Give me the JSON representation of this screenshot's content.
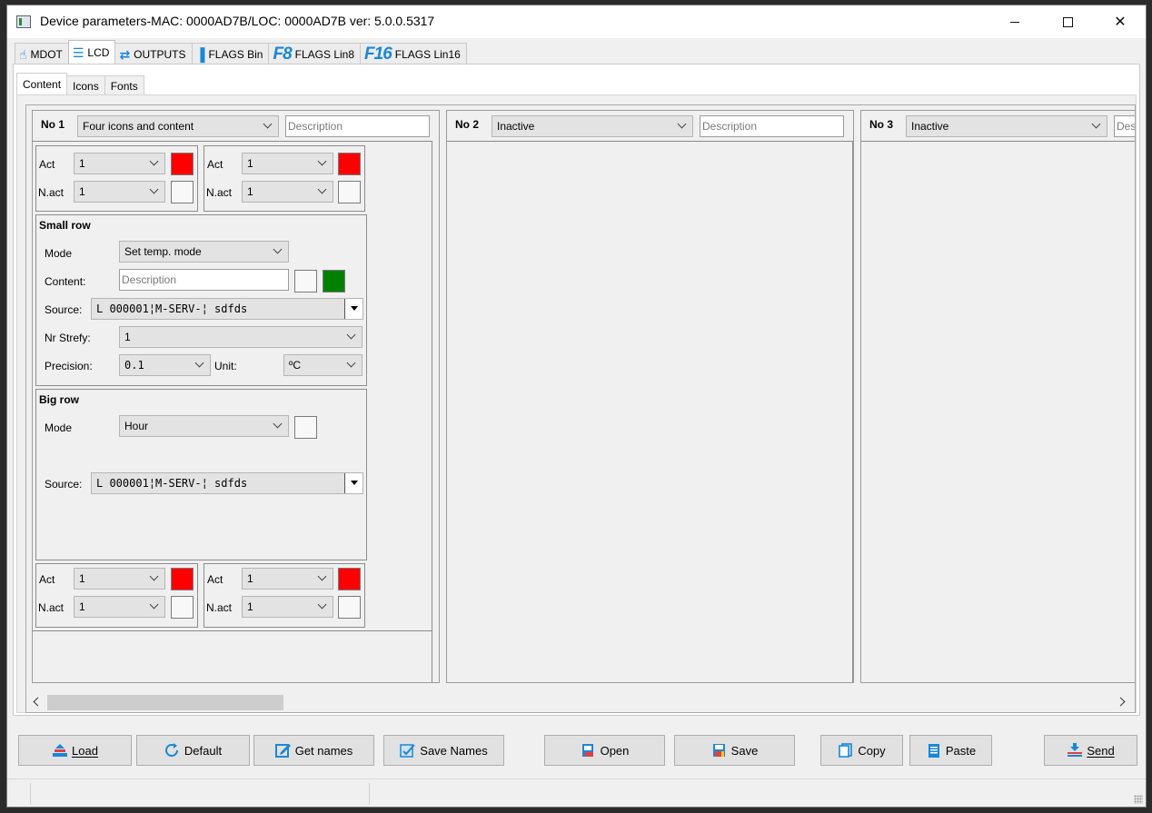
{
  "window": {
    "title": "Device parameters-MAC: 0000AD7B/LOC: 0000AD7B ver: 5.0.0.5317"
  },
  "main_tabs": [
    {
      "label": "MDOT",
      "icon": "touch-icon"
    },
    {
      "label": "LCD",
      "icon": "lcd-list-icon"
    },
    {
      "label": "OUTPUTS",
      "icon": "outputs-icon"
    },
    {
      "label": "FLAGS Bin",
      "icon": "flags-bin-icon"
    },
    {
      "label": "FLAGS Lin8",
      "icon_text": "F8"
    },
    {
      "label": "FLAGS Lin16",
      "icon_text": "F16"
    }
  ],
  "sub_tabs": [
    "Content",
    "Icons",
    "Fonts"
  ],
  "panels": [
    {
      "no": "No 1",
      "type": "Four icons and content",
      "description_placeholder": "Description",
      "top_icons": [
        {
          "act_label": "Act",
          "act_value": "1",
          "act_color": "#ff0000",
          "nact_label": "N.act",
          "nact_value": "1",
          "nact_color": "#f8f8f8"
        },
        {
          "act_label": "Act",
          "act_value": "1",
          "act_color": "#ff0000",
          "nact_label": "N.act",
          "nact_value": "1",
          "nact_color": "#f8f8f8"
        }
      ],
      "small_row": {
        "title": "Small row",
        "mode_label": "Mode",
        "mode_value": "Set temp. mode",
        "content_label": "Content:",
        "content_placeholder": "Description",
        "content_color1": "#f8f8f8",
        "content_color2": "#008000",
        "source_label": "Source:",
        "source_value": "L 000001¦M-SERV-¦ sdfds",
        "strefy_label": "Nr Strefy:",
        "strefy_value": "1",
        "precision_label": "Precision:",
        "precision_value": "0.1",
        "unit_label": "Unit:",
        "unit_value": "ºC"
      },
      "big_row": {
        "title": "Big row",
        "mode_label": "Mode",
        "mode_value": "Hour",
        "mode_color": "#f8f8f8",
        "source_label": "Source:",
        "source_value": "L 000001¦M-SERV-¦ sdfds"
      },
      "bottom_icons": [
        {
          "act_label": "Act",
          "act_value": "1",
          "act_color": "#ff0000",
          "nact_label": "N.act",
          "nact_value": "1",
          "nact_color": "#f8f8f8"
        },
        {
          "act_label": "Act",
          "act_value": "1",
          "act_color": "#ff0000",
          "nact_label": "N.act",
          "nact_value": "1",
          "nact_color": "#f8f8f8"
        }
      ]
    },
    {
      "no": "No 2",
      "type": "Inactive",
      "description_placeholder": "Description"
    },
    {
      "no": "No 3",
      "type": "Inactive",
      "description_placeholder": "Des"
    }
  ],
  "buttons": {
    "load": "Load",
    "default": "Default",
    "get_names": "Get names",
    "save_names": "Save Names",
    "open": "Open",
    "save": "Save",
    "copy": "Copy",
    "paste": "Paste",
    "send": "Send"
  },
  "colors": {
    "accent_blue": "#1a86d6",
    "red": "#ff0000",
    "green": "#008000"
  }
}
